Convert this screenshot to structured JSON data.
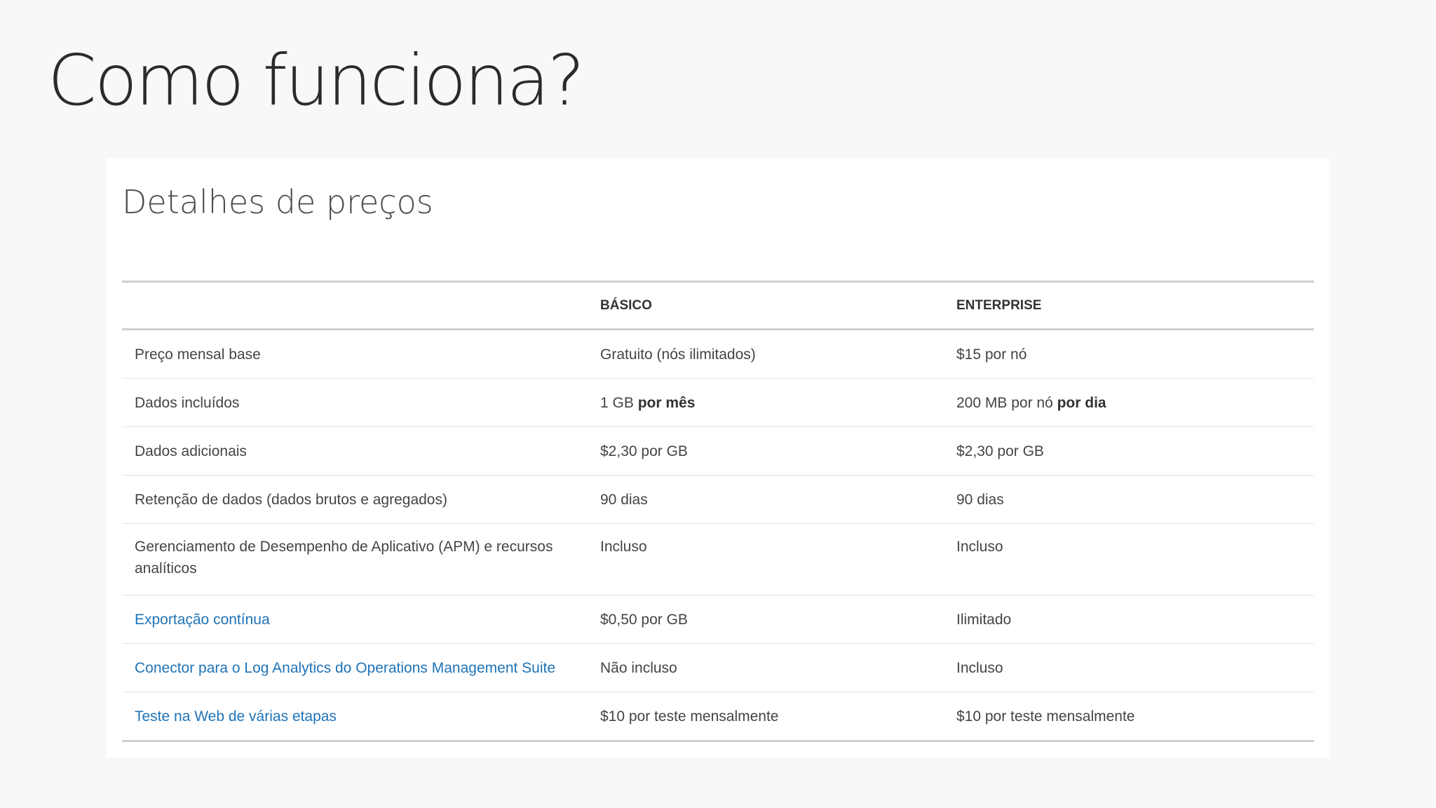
{
  "slide": {
    "title": "Como funciona?"
  },
  "card": {
    "title": "Detalhes de preços"
  },
  "table": {
    "headers": [
      "",
      "BÁSICO",
      "ENTERPRISE"
    ],
    "rows": [
      {
        "label": "Preço mensal base",
        "basic": "Gratuito (nós ilimitados)",
        "enterprise": "$15 por nó"
      },
      {
        "label": "Dados incluídos",
        "basic": "1 GB",
        "basic_bold": "por mês",
        "enterprise": "200 MB por nó",
        "enterprise_bold": "por dia"
      },
      {
        "label": "Dados adicionais",
        "basic": "$2,30 por GB",
        "enterprise": "$2,30 por GB"
      },
      {
        "label": "Retenção de dados (dados brutos e agregados)",
        "basic": "90 dias",
        "enterprise": "90 dias"
      },
      {
        "label": "Gerenciamento de Desempenho de Aplicativo (APM) e recursos analíticos",
        "basic": "Incluso",
        "enterprise": "Incluso"
      },
      {
        "label": "Exportação contínua",
        "basic": "$0,50 por GB",
        "enterprise": "Ilimitado"
      },
      {
        "label": "Conector para o Log Analytics do Operations Management Suite",
        "basic": "Não incluso",
        "enterprise": "Incluso"
      },
      {
        "label": "Teste na Web de várias etapas",
        "basic": "$10 por teste mensalmente",
        "enterprise": "$10 por teste mensalmente"
      }
    ]
  },
  "colors": {
    "link": "#1f73b7",
    "background": "#f8f8f8",
    "card": "#ffffff"
  }
}
